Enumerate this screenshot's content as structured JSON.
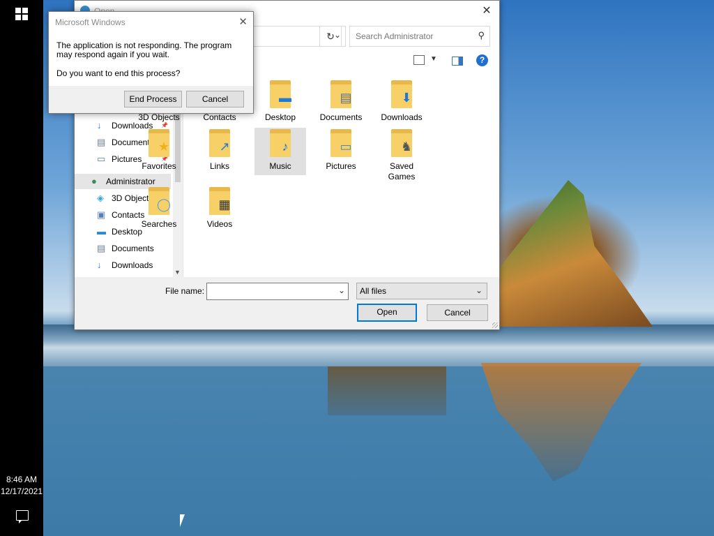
{
  "taskbar": {
    "time": "8:46 AM",
    "date": "12/17/2021"
  },
  "open_dialog": {
    "title": "Open",
    "search_placeholder": "Search Administrator",
    "nav_items": [
      {
        "label": "Downloads",
        "icon": "downloads-icon",
        "pinned": true
      },
      {
        "label": "Documents",
        "icon": "documents-icon",
        "pinned": true
      },
      {
        "label": "Pictures",
        "icon": "pictures-icon",
        "pinned": true
      },
      {
        "label": "Administrator",
        "icon": "user-icon",
        "pinned": false,
        "selected": true
      },
      {
        "label": "3D Objects",
        "icon": "cube-icon",
        "pinned": false
      },
      {
        "label": "Contacts",
        "icon": "contacts-icon",
        "pinned": false
      },
      {
        "label": "Desktop",
        "icon": "desktop-icon",
        "pinned": false
      },
      {
        "label": "Documents",
        "icon": "documents-icon",
        "pinned": false
      },
      {
        "label": "Downloads",
        "icon": "downloads-icon",
        "pinned": false
      }
    ],
    "folders": [
      {
        "label": "3D Objects",
        "overlay": "cube"
      },
      {
        "label": "Contacts",
        "overlay": "contacts"
      },
      {
        "label": "Desktop",
        "overlay": "desktop"
      },
      {
        "label": "Documents",
        "overlay": "documents"
      },
      {
        "label": "Downloads",
        "overlay": "downloads"
      },
      {
        "label": "Favorites",
        "overlay": "star"
      },
      {
        "label": "Links",
        "overlay": "link-arrow"
      },
      {
        "label": "Music",
        "overlay": "music-note",
        "selected": true
      },
      {
        "label": "Pictures",
        "overlay": "picture"
      },
      {
        "label": "Saved Games",
        "overlay": "chess-piece"
      },
      {
        "label": "Searches",
        "overlay": "magnifier"
      },
      {
        "label": "Videos",
        "overlay": "film"
      }
    ],
    "file_name_label": "File name:",
    "file_name_value": "",
    "filter_value": "All files",
    "open_label": "Open",
    "cancel_label": "Cancel"
  },
  "not_responding_dialog": {
    "title": "Microsoft Windows",
    "message": "The application is not responding. The program may respond again if you wait.",
    "question": "Do you want to end this process?",
    "end_label": "End Process",
    "cancel_label": "Cancel"
  },
  "colors": {
    "accent": "#0078d7",
    "folder": "#f7d068",
    "taskbar": "#000000"
  }
}
